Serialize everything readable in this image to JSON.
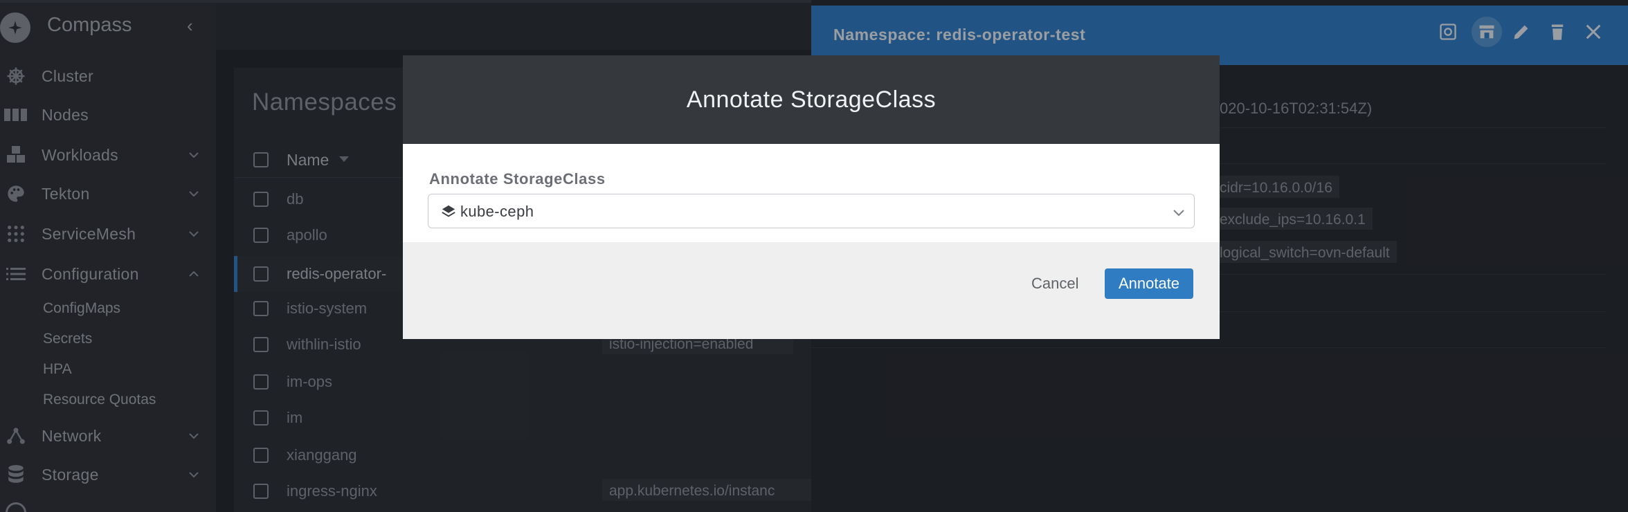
{
  "app": {
    "title": "Compass"
  },
  "sidebar": {
    "items": [
      {
        "label": "Cluster",
        "icon": "helm-wheel-icon"
      },
      {
        "label": "Nodes",
        "icon": "nodes-icon"
      },
      {
        "label": "Workloads",
        "icon": "cubes-icon"
      },
      {
        "label": "Tekton",
        "icon": "palette-icon"
      },
      {
        "label": "ServiceMesh",
        "icon": "grid-dots-icon"
      },
      {
        "label": "Configuration",
        "icon": "list-icon"
      },
      {
        "label": "Network",
        "icon": "network-icon"
      },
      {
        "label": "Storage",
        "icon": "database-icon"
      }
    ],
    "config_sub": [
      "ConfigMaps",
      "Secrets",
      "HPA",
      "Resource Quotas"
    ]
  },
  "namespaces": {
    "title": "Namespaces",
    "column_name": "Name",
    "rows": [
      "db",
      "apollo",
      "redis-operator-",
      "istio-system",
      "withlin-istio",
      "im-ops",
      "im",
      "xianggang",
      "ingress-nginx"
    ],
    "label_tags": [
      "istio-injection=enabled",
      "app.kubernetes.io/instanc"
    ]
  },
  "drawer": {
    "title": "Namespace: redis-operator-test",
    "created": "020-10-16T02:31:54Z)",
    "tags": [
      "cidr=10.16.0.0/16",
      "exclude_ips=10.16.0.1",
      "logical_switch=ovn-default"
    ]
  },
  "modal": {
    "title": "Annotate StorageClass",
    "field_label": "Annotate StorageClass",
    "selected_value": "kube-ceph",
    "cancel_label": "Cancel",
    "confirm_label": "Annotate"
  },
  "colors": {
    "accent": "#2f7cc3",
    "sidebar_bg": "#2e3136",
    "modal_header": "#35383d"
  }
}
